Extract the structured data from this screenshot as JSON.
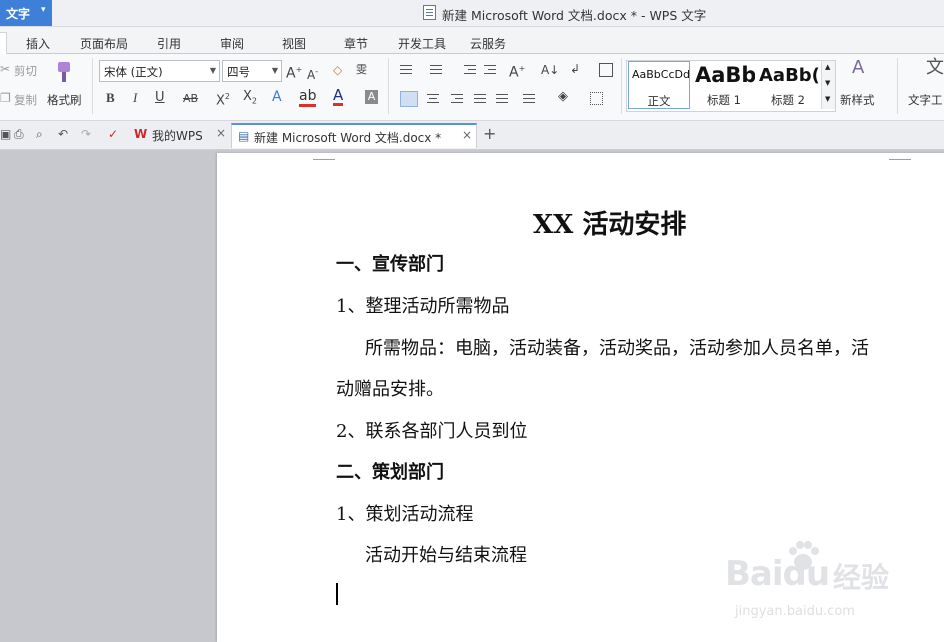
{
  "app": {
    "menu_label": "文字",
    "menu_caret": "▾"
  },
  "window": {
    "title": "新建 Microsoft Word 文档.docx * - WPS 文字"
  },
  "menu_tabs": [
    "插入",
    "页面布局",
    "引用",
    "审阅",
    "视图",
    "章节",
    "开发工具",
    "云服务"
  ],
  "clipboard": {
    "cut": "剪切",
    "copy": "复制",
    "format_painter": "格式刷"
  },
  "font": {
    "family": "宋体 (正文)",
    "size": "四号"
  },
  "styles": {
    "items": [
      {
        "sample": "AaBbCcDd",
        "name": "正文"
      },
      {
        "sample": "AaBb",
        "name": "标题 1"
      },
      {
        "sample": "AaBb(",
        "name": "标题 2"
      }
    ],
    "new_style": "新样式",
    "text_tools": "文字工"
  },
  "tabs": {
    "my_wps": "我的WPS",
    "document": "新建 Microsoft Word 文档.docx *",
    "close_glyph": "×",
    "new_tab_glyph": "+"
  },
  "document": {
    "title": "XX 活动安排",
    "lines": [
      {
        "text": "一、宣传部门",
        "style": "heading"
      },
      {
        "text": "1、整理活动所需物品",
        "style": "body"
      },
      {
        "text": "所需物品：电脑，活动装备，活动奖品，活动参加人员名单，活",
        "style": "indent"
      },
      {
        "text": "动赠品安排。",
        "style": "body"
      },
      {
        "text": "2、联系各部门人员到位",
        "style": "body"
      },
      {
        "text": "二、策划部门",
        "style": "heading"
      },
      {
        "text": "1、策划活动流程",
        "style": "body"
      },
      {
        "text": "活动开始与结束流程",
        "style": "indent"
      }
    ]
  },
  "watermark": {
    "brand": "Bai",
    "brand_suffix": "du",
    "cn": "经验",
    "url": "jingyan.baidu.com"
  },
  "colors": {
    "accent": "#3e7fd8",
    "font_color_red": "#d9302c",
    "font_color_blue": "#1f4fd6"
  },
  "icons": [
    "scissors-icon",
    "copy-icon",
    "format-painter-icon",
    "bold-icon",
    "italic-icon",
    "underline-icon",
    "strikethrough-icon",
    "superscript-icon",
    "subscript-icon",
    "bullets-icon",
    "numbering-icon",
    "align-left-icon",
    "align-center-icon",
    "align-right-icon",
    "justify-icon",
    "distribute-icon",
    "line-spacing-icon",
    "shading-icon",
    "borders-icon",
    "table-icon",
    "save-icon",
    "print-icon",
    "preview-icon",
    "undo-icon",
    "redo-icon",
    "new-style-icon"
  ]
}
